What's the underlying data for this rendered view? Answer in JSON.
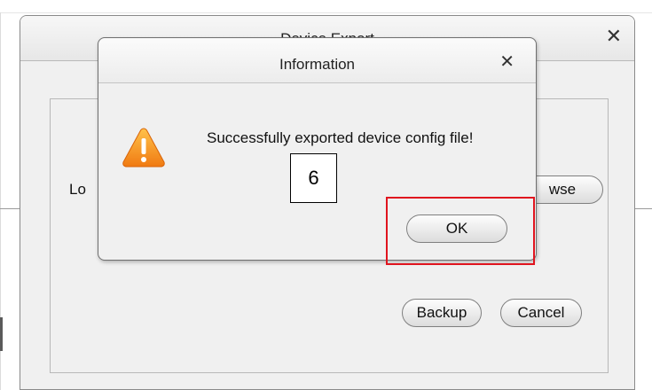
{
  "parent_dialog": {
    "title": "Device Export",
    "close_glyph": "✕",
    "location_label": "Lo",
    "browse_label": "wse",
    "backup_label": "Backup",
    "cancel_label": "Cancel"
  },
  "info_dialog": {
    "title": "Information",
    "close_glyph": "✕",
    "icon": "warning-icon",
    "message": "Successfully exported device config file!",
    "ok_label": "OK"
  },
  "annotation": {
    "step_number": "6",
    "highlight_color": "#e0141e"
  }
}
